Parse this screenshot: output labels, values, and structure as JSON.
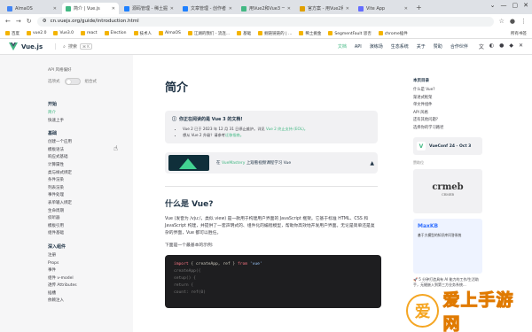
{
  "browser": {
    "tabs": [
      {
        "title": "AlmaOS",
        "color": "#4285f4",
        "active": false
      },
      {
        "title": "简介 | Vue.js",
        "color": "#42b883",
        "active": true
      },
      {
        "title": "源码管理 - 稀土掘金",
        "color": "#1e80ff",
        "active": false
      },
      {
        "title": "文章管理 - 创作者中心 - 稀",
        "color": "#1e80ff",
        "active": false
      },
      {
        "title": "用Vue2和Vue3 一键学习Driv",
        "color": "#42b883",
        "active": false
      },
      {
        "title": "官方案 - 用Vue2和Vue3 分支",
        "color": "#e0a000",
        "active": false
      },
      {
        "title": "Vite App",
        "color": "#646cff",
        "active": false
      }
    ],
    "new_tab": "+",
    "url": "cn.vuejs.org/guide/introduction.html",
    "bookmarks": [
      "百度",
      "vue2.0",
      "Vue3.0",
      "react",
      "Election",
      "技术人",
      "AlmaOS",
      "江湖的我们 - 流连...",
      "基础",
      "掘链链链的  |  ...",
      "稀土掘金",
      "SegmentFault 思否",
      "chrome插件"
    ],
    "bookmarks_right": "所有书签"
  },
  "nav": {
    "logo": "Vue.js",
    "search": "搜索",
    "search_kbd": "⌘ K",
    "menu": [
      "文档",
      "API",
      "演练场",
      "生态系统",
      "关于",
      "赞助",
      "合作伙伴"
    ]
  },
  "sidebar": {
    "api_label": "API 风格偏好",
    "options": "选项式",
    "composition": "组合式",
    "groups": [
      {
        "title": "开始",
        "items": [
          "简介",
          "快速上手"
        ]
      },
      {
        "title": "基础",
        "items": [
          "创建一个应用",
          "模板语法",
          "响应式基础",
          "计算属性",
          "类与样式绑定",
          "条件渲染",
          "列表渲染",
          "事件处理",
          "表单输入绑定",
          "生命周期",
          "侦听器",
          "模板引用",
          "组件基础"
        ]
      },
      {
        "title": "深入组件",
        "items": [
          "注册",
          "Props",
          "事件",
          "组件 v-model",
          "透传 Attributes",
          "插槽",
          "依赖注入"
        ]
      }
    ],
    "active": "简介"
  },
  "main": {
    "title": "简介",
    "tip_title": "你正在阅读的是 Vue 3 的文档!",
    "tip_items": [
      {
        "text": "Vue 2 已于 2023 年 12 月 31 日停止维护。详见 ",
        "link": "Vue 2 终止支持 (EOL)。"
      },
      {
        "text": "想从 Vue 2 升级？请参考",
        "link": "迁移指南。"
      }
    ],
    "banner_pre": "在",
    "banner_link": "VueMastery",
    "banner_post": "上观看视频课程学习 Vue",
    "section_title": "什么是 Vue?",
    "para1": "Vue (发音为 /vjuː/，类似 view) 是一款用于构建用户界面的 JavaScript 框架。它基于标准 HTML、CSS 和 JavaScript 构建，并提供了一套声明式的、组件化的编程模型，帮助你高效地开发用户界面。无论是简单还是复杂的界面，Vue 都可以胜任。",
    "para2": "下面是一个最基本的示例:",
    "code": {
      "l1_kw": "import",
      "l1_mid": " { createApp, ref } ",
      "l1_from": "from",
      "l1_str": " 'vue'",
      "l2": "createApp({",
      "l3": "  setup() {",
      "l4": "    return {",
      "l5": "      count: ref(0)"
    }
  },
  "aside": {
    "outline_title": "本页目录",
    "outline": [
      "什么是 Vue?",
      "渐进式框架",
      "单文件组件",
      "API 风格",
      "还有其他问题?",
      "选择你的学习路径"
    ],
    "event": "VueConf 24 - Oct 3",
    "sponsor_label": "赞助位",
    "ad1": "crmeb",
    "ad1_sub": "CRMEB",
    "ad2": "MaxKB",
    "ad2_sub": "基于大模型的知识库问答系统",
    "ad_text": "🚀 5 分钟打造具有 AI 能力的工作/生活助手，无缝嵌入到第三方业务系统..."
  },
  "watermark": "爱上手游网"
}
